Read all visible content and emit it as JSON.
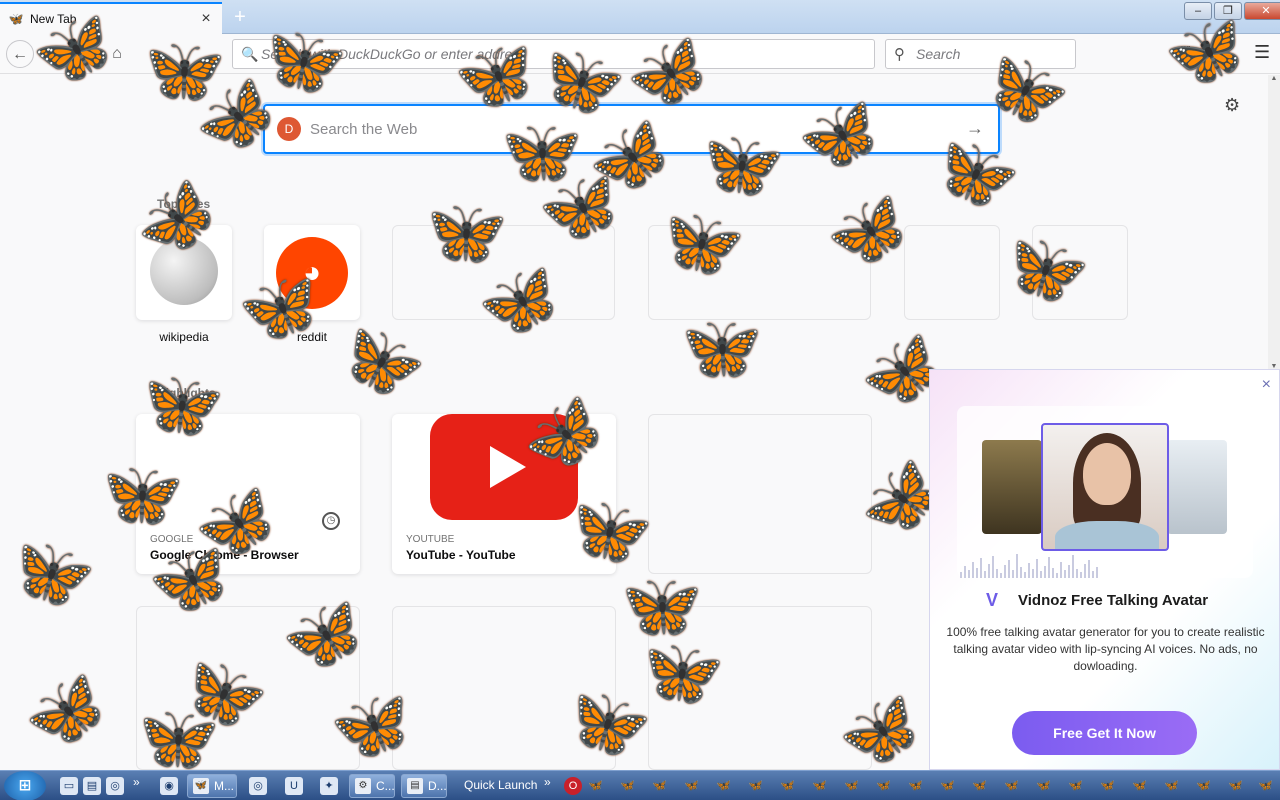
{
  "browser": {
    "tab_title": "New Tab",
    "tab_close": "×",
    "new_tab": "+",
    "url_placeholder": "Search with DuckDuckGo or enter address",
    "search_placeholder": "Search",
    "window_controls": [
      "–",
      "❐",
      "✕"
    ]
  },
  "newtab": {
    "web_search_placeholder": "Search the Web",
    "top_sites_title": "Top Sites",
    "highlights_title": "Highlights",
    "top_sites": [
      {
        "label": "wikipedia"
      },
      {
        "label": "reddit"
      }
    ],
    "highlights": [
      {
        "source": "GOOGLE",
        "title": "Google Chrome - Browser"
      },
      {
        "source": "YOUTUBE",
        "title": "YouTube - YouTube"
      }
    ]
  },
  "ad": {
    "brand": "Vidnoz Free Talking Avatar",
    "description": "100% free talking avatar generator for you to create realistic talking avatar video with lip-syncing AI voices. No ads, no dowloading.",
    "cta": "Free Get It Now",
    "close": "×"
  },
  "taskbar": {
    "buttons": [
      {
        "label": "M..."
      },
      {
        "label": "C..."
      },
      {
        "label": "D..."
      }
    ],
    "quick_launch": "Quick Launch",
    "more": "»"
  },
  "colors": {
    "accent": "#0a84ff",
    "butterfly": "#e8741a",
    "ad_button": "#7b5cf0",
    "youtube": "#e62117",
    "reddit": "#ff4500"
  }
}
